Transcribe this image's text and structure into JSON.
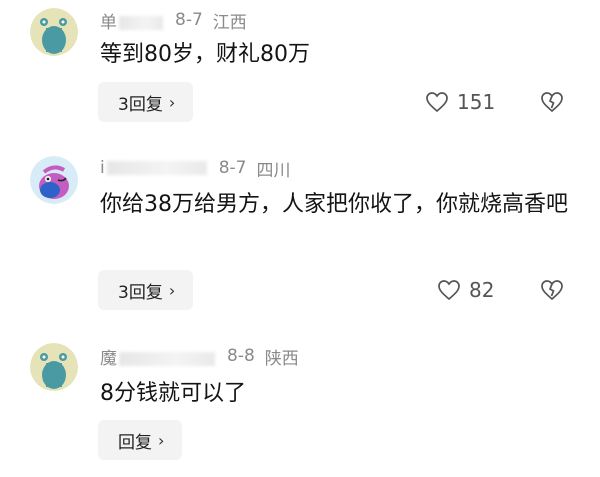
{
  "comments": [
    {
      "name_visible": "单",
      "date": "8-7",
      "location": "江西",
      "text": "等到80岁，财礼80万",
      "reply_label": "3回复",
      "likes": "151"
    },
    {
      "name_visible": "i",
      "date": "8-7",
      "location": "四川",
      "text": "你给38万给男方，人家把你收了，你就烧高香吧",
      "reply_label": "3回复",
      "likes": "82"
    },
    {
      "name_visible": "魔",
      "date": "8-8",
      "location": "陕西",
      "text": "8分钱就可以了",
      "reply_label": "回复",
      "likes": ""
    }
  ],
  "icons": {
    "reply_chevron": "chevron-right-icon",
    "like": "heart-icon",
    "dislike": "broken-heart-icon"
  },
  "colors": {
    "meta_text": "#8a8a8a",
    "reply_bg": "#f3f3f3"
  }
}
